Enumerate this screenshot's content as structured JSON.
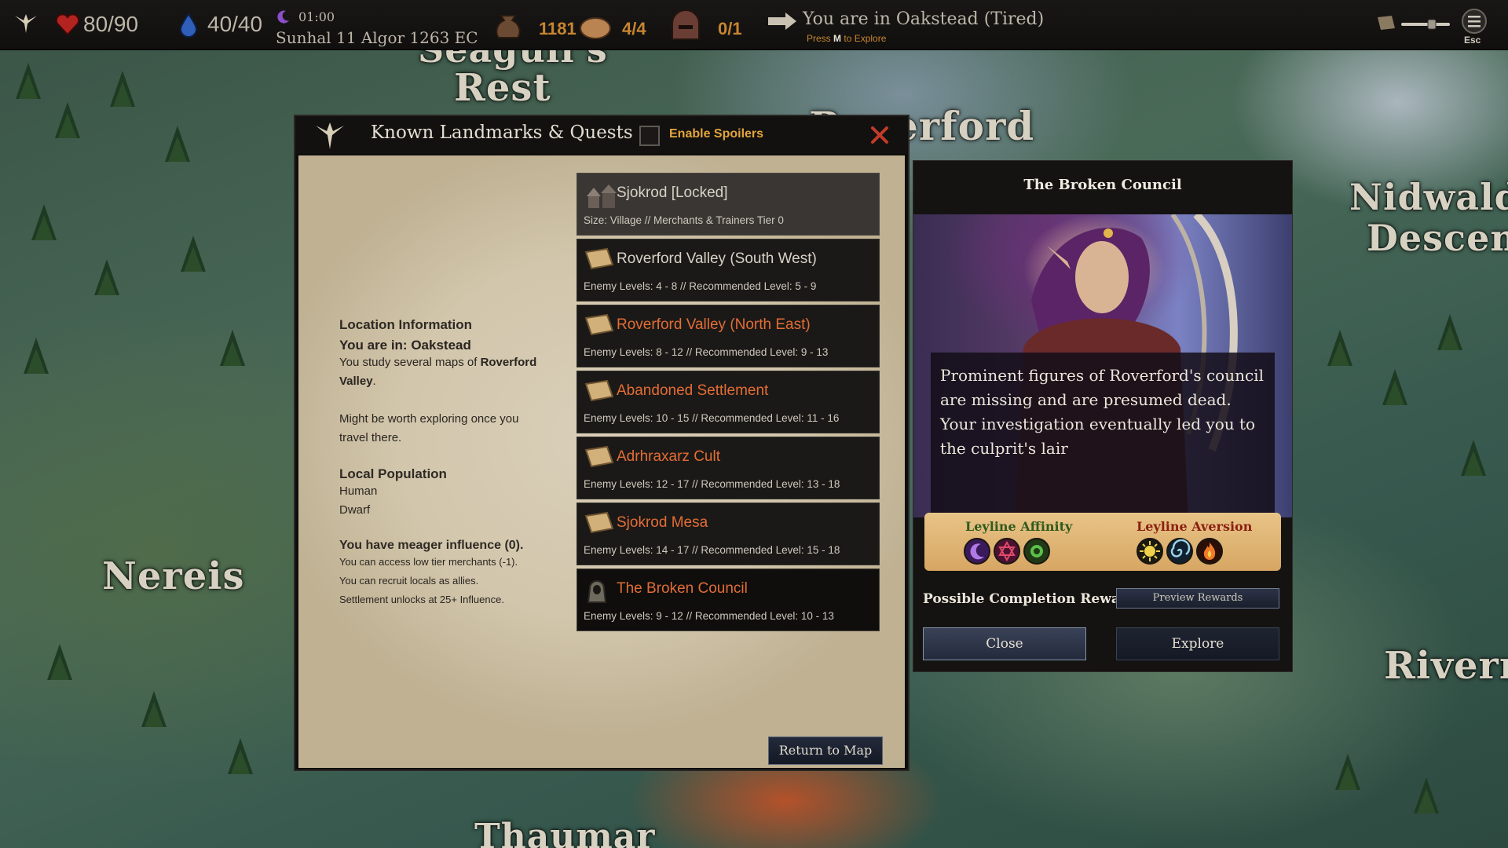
{
  "topbar": {
    "health": "80/90",
    "mana": "40/40",
    "time": "01:00",
    "date": "Sunhal 11 Algor 1263 EC",
    "gold": "1181",
    "food": "4/4",
    "party": "0/1",
    "location_text": "You are in Oakstead (Tired)",
    "explore_hint_prefix": "Press",
    "explore_hint_key": "M",
    "explore_hint_suffix": "to Explore",
    "esc_label": "Esc"
  },
  "map_labels": {
    "seagulls_rest_1": "Seagull's",
    "seagulls_rest_2": "Rest",
    "roverford": "Roverford",
    "nidwalds_1": "Nidwald's",
    "nidwalds_2": "Descent",
    "nereis": "Nereis",
    "rivermouth": "Riverm",
    "thaumar": "Thaumar"
  },
  "landmarks": {
    "title": "Known Landmarks & Quests",
    "spoilers_label": "Enable Spoilers",
    "location_info": {
      "heading": "Location Information",
      "you_are_in_label": "You are in:",
      "you_are_in_value": "Oakstead",
      "study_prefix": "You study several maps of",
      "study_place": "Roverford Valley",
      "study_suffix": ".",
      "explore_note": "Might be worth exploring once you travel there.",
      "population_heading": "Local Population",
      "population": [
        "Human",
        "Dwarf"
      ],
      "influence_heading": "You have meager influence (0).",
      "influence_notes": [
        "You can access low tier merchants (-1).",
        "You can recruit locals as allies.",
        "Settlement unlocks at 25+ Influence."
      ]
    },
    "items": [
      {
        "name": "Sjokrod [Locked]",
        "sub": "Size: Village // Merchants & Trainers Tier 0",
        "icon": "village-icon"
      },
      {
        "name": "Roverford Valley (South West)",
        "sub": "Enemy Levels: 4 - 8 // Recommended Level: 5 - 9",
        "icon": "scroll-map-icon"
      },
      {
        "name": "Roverford Valley (North East)",
        "sub": "Enemy Levels: 8 - 12 // Recommended Level: 9 - 13",
        "icon": "scroll-map-icon"
      },
      {
        "name": "Abandoned Settlement",
        "sub": "Enemy Levels: 10 - 15 // Recommended Level: 11 - 16",
        "icon": "scroll-map-icon"
      },
      {
        "name": "Adrhraxarz Cult",
        "sub": "Enemy Levels: 12 - 17 // Recommended Level: 13 - 18",
        "icon": "scroll-map-icon"
      },
      {
        "name": "Sjokrod Mesa",
        "sub": "Enemy Levels: 14 - 17 // Recommended Level: 15 - 18",
        "icon": "scroll-map-icon"
      },
      {
        "name": "The Broken Council",
        "sub": "Enemy Levels: 9 - 12 // Recommended Level: 10 - 13",
        "icon": "hooded-figure-icon"
      }
    ],
    "return_button": "Return to Map"
  },
  "quest": {
    "title": "The Broken Council",
    "description": "Prominent figures of Roverford's council are missing and are presumed dead. Your investigation eventually led you to the culprit's lair",
    "affinity_label": "Leyline Affinity",
    "aversion_label": "Leyline Aversion",
    "affinity_icons": [
      "moon-icon",
      "hexagram-icon",
      "nature-icon"
    ],
    "aversion_icons": [
      "sun-icon",
      "wind-swirl-icon",
      "fire-icon"
    ],
    "rewards_label": "Possible Completion Rewards",
    "preview_button": "Preview Rewards",
    "close_button": "Close",
    "explore_button": "Explore"
  },
  "colors": {
    "accent_orange": "#e26d35",
    "spoiler_gold": "#e4a53a",
    "affinity_green": "#2f5a1e",
    "aversion_red": "#8a1e12"
  }
}
